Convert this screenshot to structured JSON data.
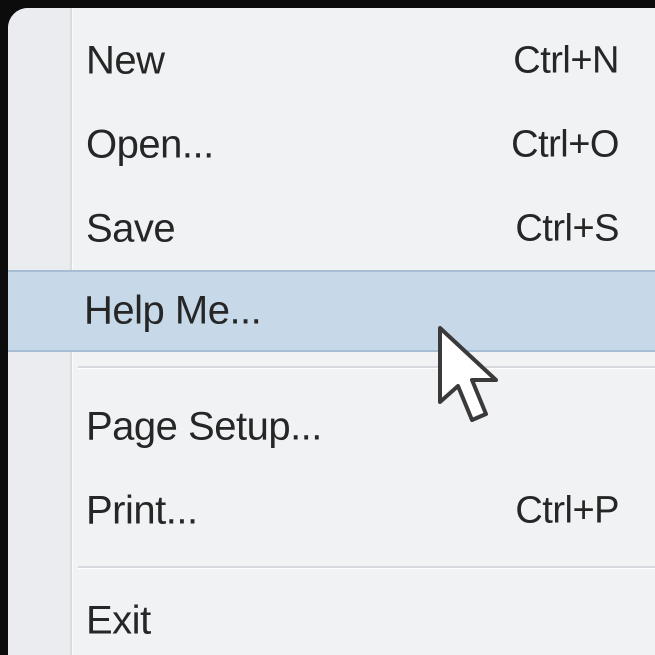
{
  "menu": {
    "items": [
      {
        "label": "New",
        "shortcut": "Ctrl+N"
      },
      {
        "label": "Open...",
        "shortcut": "Ctrl+O"
      },
      {
        "label": "Save",
        "shortcut": "Ctrl+S"
      },
      {
        "label": "Help Me...",
        "shortcut": ""
      },
      {
        "label": "Page Setup...",
        "shortcut": ""
      },
      {
        "label": "Print...",
        "shortcut": "Ctrl+P"
      },
      {
        "label": "Exit",
        "shortcut": ""
      }
    ],
    "highlighted_item": "Help Me..."
  },
  "colors": {
    "menu_background": "#f0f2f4",
    "highlight": "#c7d8e8",
    "highlight_border": "#a6bdd4",
    "text": "#262626"
  },
  "icons": {
    "cursor": "mouse-pointer-arrow-icon"
  }
}
